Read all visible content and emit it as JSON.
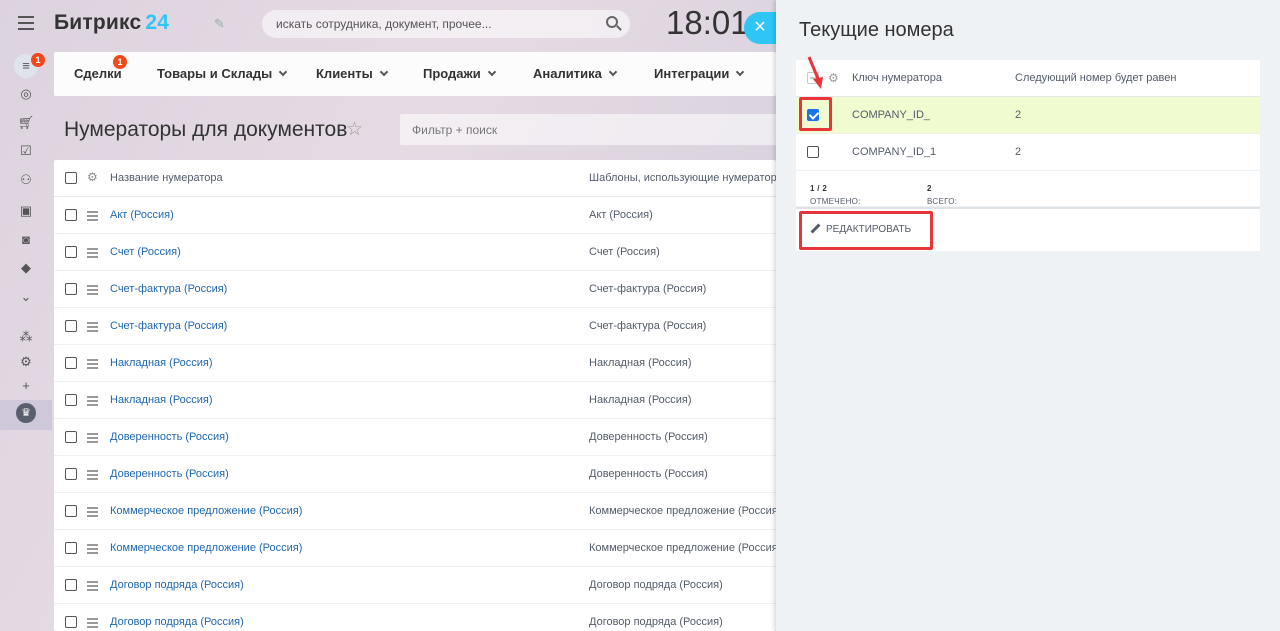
{
  "header": {
    "logo_text": "Битрикс",
    "logo_num": "24",
    "search_placeholder": "искать сотрудника, документ, прочее...",
    "clock": "18:01",
    "close_glyph": "×"
  },
  "rail": {
    "feed_badge": "1",
    "icons": [
      "filter-icon",
      "target-icon",
      "cart-icon",
      "task-icon",
      "people-icon",
      "contact-card-icon",
      "robot-icon",
      "box-icon",
      "chevron-down-circle-icon",
      "sitemap-icon",
      "gear-icon",
      "plus-icon",
      "crown-icon"
    ]
  },
  "nav": {
    "items": [
      {
        "label": "Сделки",
        "badge": "1"
      },
      {
        "label": "Товары и Склады"
      },
      {
        "label": "Клиенты"
      },
      {
        "label": "Продажи"
      },
      {
        "label": "Аналитика"
      },
      {
        "label": "Интеграции"
      }
    ]
  },
  "page": {
    "title": "Нумераторы для документов",
    "filter_placeholder": "Фильтр + поиск"
  },
  "grid": {
    "col1": "Название нумератора",
    "col2": "Шаблоны, использующие нумератор",
    "rows": [
      {
        "name": "Акт (Россия)",
        "tpl": "Акт (Россия)"
      },
      {
        "name": "Счет (Россия)",
        "tpl": "Счет (Россия)"
      },
      {
        "name": "Счет-фактура (Россия)",
        "tpl": "Счет-фактура (Россия)"
      },
      {
        "name": "Счет-фактура (Россия)",
        "tpl": "Счет-фактура (Россия)"
      },
      {
        "name": "Накладная (Россия)",
        "tpl": "Накладная (Россия)"
      },
      {
        "name": "Накладная (Россия)",
        "tpl": "Накладная (Россия)"
      },
      {
        "name": "Доверенность (Россия)",
        "tpl": "Доверенность (Россия)"
      },
      {
        "name": "Доверенность (Россия)",
        "tpl": "Доверенность (Россия)"
      },
      {
        "name": "Коммерческое предложение (Россия)",
        "tpl": "Коммерческое предложение (Россия)"
      },
      {
        "name": "Коммерческое предложение (Россия)",
        "tpl": "Коммерческое предложение (Россия)"
      },
      {
        "name": "Договор подряда (Россия)",
        "tpl": "Договор подряда (Россия)"
      },
      {
        "name": "Договор подряда (Россия)",
        "tpl": "Договор подряда (Россия)"
      }
    ]
  },
  "panel": {
    "title": "Текущие номера",
    "col1": "Ключ нумератора",
    "col2": "Следующий номер будет равен",
    "rows": [
      {
        "key": "COMPANY_ID_",
        "next": "2",
        "checked": true
      },
      {
        "key": "COMPANY_ID_1",
        "next": "2",
        "checked": false
      }
    ],
    "selected_label": "Отмечено:",
    "selected_value": "1 / 2",
    "total_label": "Всего:",
    "total_value": "2",
    "edit_label": "Редактировать"
  },
  "colors": {
    "accent": "#2fc6f6",
    "badge": "#f54819",
    "highlight": "#e8353a",
    "selected_row": "#f1fbd0",
    "link": "#2067b0"
  }
}
